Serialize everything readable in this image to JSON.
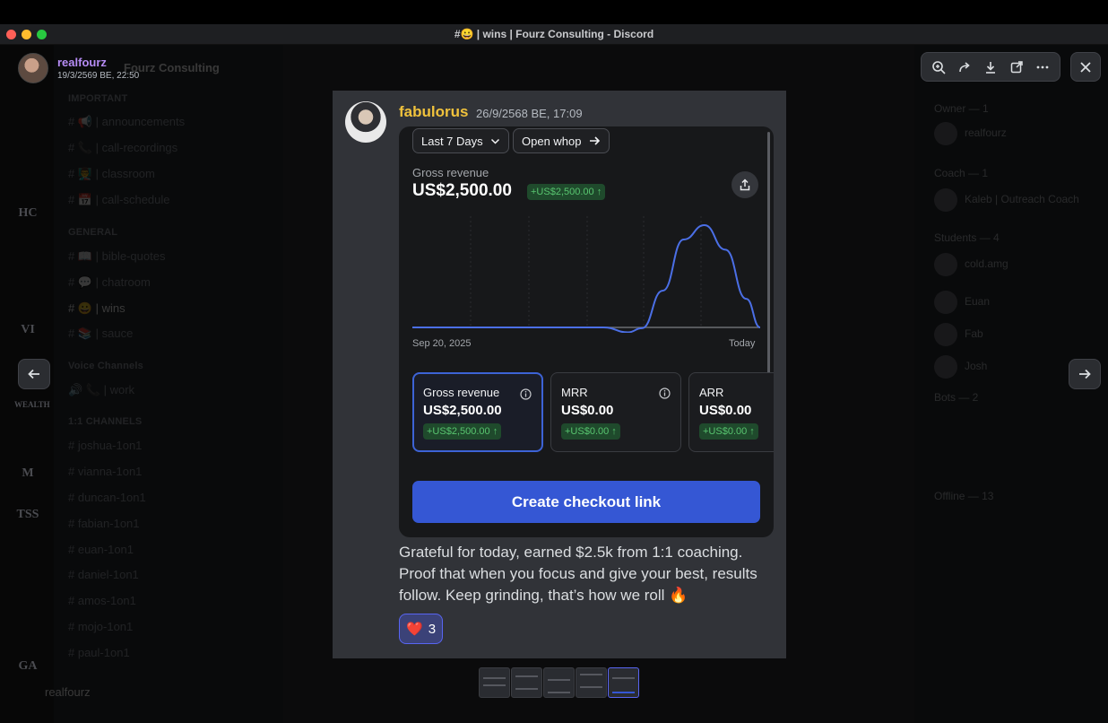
{
  "window": {
    "title": "#😀 | wins | Fourz Consulting - Discord",
    "traffic_colors": [
      "#ff5f57",
      "#febc2e",
      "#28c840"
    ]
  },
  "background": {
    "server_name": "Fourz Consulting",
    "channels": [
      {
        "label": "IMPORTANT",
        "type": "category"
      },
      {
        "label": "# 📢 | announcements",
        "type": "channel"
      },
      {
        "label": "# 📞 | call-recordings",
        "type": "channel"
      },
      {
        "label": "# 👨‍🏫 | classroom",
        "type": "channel"
      },
      {
        "label": "# 📅 | call-schedule",
        "type": "channel"
      },
      {
        "label": "GENERAL",
        "type": "category"
      },
      {
        "label": "# 📖 | bible-quotes",
        "type": "channel"
      },
      {
        "label": "# 💬 | chatroom",
        "type": "channel"
      },
      {
        "label": "# 😀 | wins",
        "type": "active"
      },
      {
        "label": "# 📚 | sauce",
        "type": "channel"
      },
      {
        "label": "Voice Channels",
        "type": "category"
      },
      {
        "label": "🔊 📞 | work",
        "type": "channel"
      },
      {
        "label": "1:1 CHANNELS",
        "type": "category"
      },
      {
        "label": "# joshua-1on1",
        "type": "channel"
      },
      {
        "label": "# vianna-1on1",
        "type": "channel"
      },
      {
        "label": "# duncan-1on1",
        "type": "channel"
      },
      {
        "label": "# fabian-1on1",
        "type": "channel"
      },
      {
        "label": "# euan-1on1",
        "type": "channel"
      },
      {
        "label": "# daniel-1on1",
        "type": "channel"
      },
      {
        "label": "# amos-1on1",
        "type": "channel"
      },
      {
        "label": "# mojo-1on1",
        "type": "channel"
      },
      {
        "label": "# paul-1on1",
        "type": "channel"
      }
    ],
    "guild_labels": [
      "HC",
      "VI",
      "WEALTH",
      "M",
      "TSS",
      "GA"
    ],
    "members": [
      {
        "label": "Owner — 1",
        "type": "header"
      },
      {
        "label": "realfourz",
        "type": "member"
      },
      {
        "label": "Coach — 1",
        "type": "header"
      },
      {
        "label": "Kaleb | Outreach Coach",
        "type": "member"
      },
      {
        "label": "Students — 4",
        "type": "header"
      },
      {
        "label": "cold.amg",
        "type": "member"
      },
      {
        "label": "Euan",
        "type": "member"
      },
      {
        "label": "Fab",
        "type": "member"
      },
      {
        "label": "Josh",
        "type": "member"
      },
      {
        "label": "Bots — 2",
        "type": "header"
      },
      {
        "label": "Offline — 13",
        "type": "header"
      }
    ],
    "current_user": "realfourz"
  },
  "viewer": {
    "uploader_name": "realfourz",
    "uploader_date": "19/3/2569 BE, 22:50"
  },
  "message": {
    "author": "fabulorus",
    "timestamp": "26/9/2568 BE, 17:09",
    "text": "Grateful for today, earned $2.5k from 1:1 coaching. Proof that when you focus and give your best, results follow. Keep grinding, that’s how we roll 🔥",
    "reaction_emoji": "❤️",
    "reaction_count": "3",
    "author_color": "#f0c23c"
  },
  "dashboard": {
    "range_label": "Last 7 Days",
    "open_label": "Open whop",
    "gross_label": "Gross revenue",
    "gross_value": "US$2,500.00",
    "gross_delta": "+US$2,500.00 ↑",
    "start_date": "Sep 20, 2025",
    "end_date": "Today",
    "metrics": [
      {
        "title": "Gross revenue",
        "value": "US$2,500.00",
        "delta": "+US$2,500.00 ↑"
      },
      {
        "title": "MRR",
        "value": "US$0.00",
        "delta": "+US$0.00 ↑"
      },
      {
        "title": "ARR",
        "value": "US$0.00",
        "delta": "+US$0.00 ↑"
      }
    ],
    "cta_label": "Create checkout link",
    "accent_color": "#3557d4",
    "revenue_series": [
      {
        "t": 0.0,
        "v": 0
      },
      {
        "t": 0.55,
        "v": 0
      },
      {
        "t": 0.62,
        "v": -120
      },
      {
        "t": 0.66,
        "v": -20
      },
      {
        "t": 0.72,
        "v": 900
      },
      {
        "t": 0.78,
        "v": 2150
      },
      {
        "t": 0.84,
        "v": 2500
      },
      {
        "t": 0.9,
        "v": 1900
      },
      {
        "t": 0.96,
        "v": 700
      },
      {
        "t": 1.0,
        "v": 0
      }
    ]
  }
}
